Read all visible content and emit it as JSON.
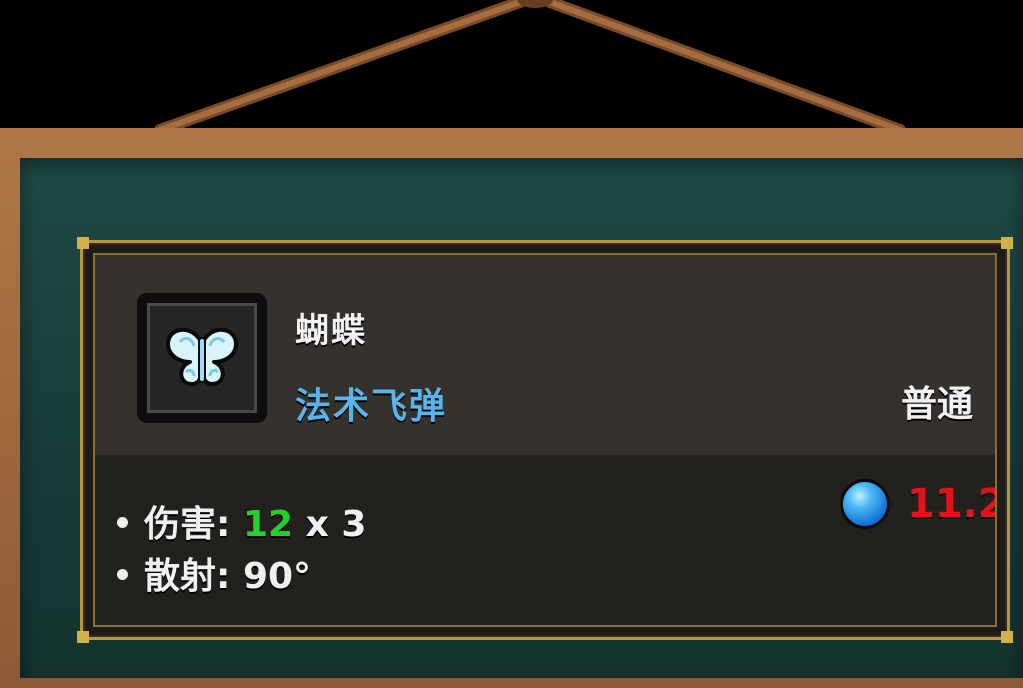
{
  "spell": {
    "name": "蝴蝶",
    "type": "法术飞弹",
    "rarity": "普通",
    "icon": "butterfly-icon",
    "mana_icon": "mana-orb-icon",
    "mana_cost": "11.2",
    "stats": {
      "damage": {
        "label": "伤害:",
        "value": "12",
        "multiplier": "x 3"
      },
      "spread": {
        "label": "散射:",
        "value": "90°"
      }
    }
  },
  "colors": {
    "board": "#1f4a45",
    "frame": "#a06c40",
    "card_border": "#b89540",
    "type_text": "#58b4ea",
    "damage_value": "#22d22a",
    "mana_cost": "#e0141c",
    "mana_orb": "#2a9cf0"
  }
}
